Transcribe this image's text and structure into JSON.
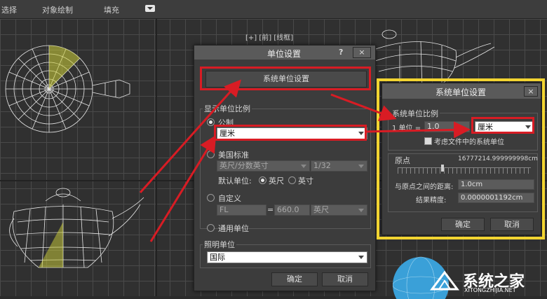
{
  "menubar": {
    "select": "选择",
    "object_paint": "对象绘制",
    "fill": "填充"
  },
  "viewport": {
    "label": "[+] [前] [线框]"
  },
  "units_dialog": {
    "title": "单位设置",
    "help": "?",
    "close": "×",
    "system_units_button": "系统单位设置",
    "display_scale_label": "显示单位比例",
    "metric_label": "公制",
    "metric_value": "厘米",
    "us_standard_label": "美国标准",
    "us_value": "英尺/分数英寸",
    "us_fraction": "1/32",
    "default_units_label": "默认单位:",
    "feet_label": "英尺",
    "inches_label": "英寸",
    "custom_label": "自定义",
    "custom_name": "FL",
    "custom_equals": "=",
    "custom_value": "660.0",
    "custom_unit": "英尺",
    "generic_label": "通用单位",
    "lighting_label": "照明单位",
    "lighting_value": "国际",
    "ok": "确定",
    "cancel": "取消"
  },
  "system_dialog": {
    "title": "系统单位设置",
    "close": "×",
    "scale_group_label": "系统单位比例",
    "one_unit_label": "1 单位 =",
    "one_unit_value": "1.0",
    "unit_select": "厘米",
    "consider_file_units": "考虑文件中的系统单位",
    "origin_label": "原点",
    "origin_value": "16777214.999999998cm",
    "distance_label": "与原点之间的距离:",
    "distance_value": "1.0cm",
    "precision_label": "结果精度:",
    "precision_value": "0.0000001192cm",
    "ok": "确定",
    "cancel": "取消"
  },
  "watermark": {
    "brand": "系统之家",
    "url": "XITONGZHIJIA.NET"
  },
  "colors": {
    "annotation_red": "#d81c24",
    "highlight_gold": "#f2d431",
    "dialog_bg": "#3c3c3c"
  }
}
